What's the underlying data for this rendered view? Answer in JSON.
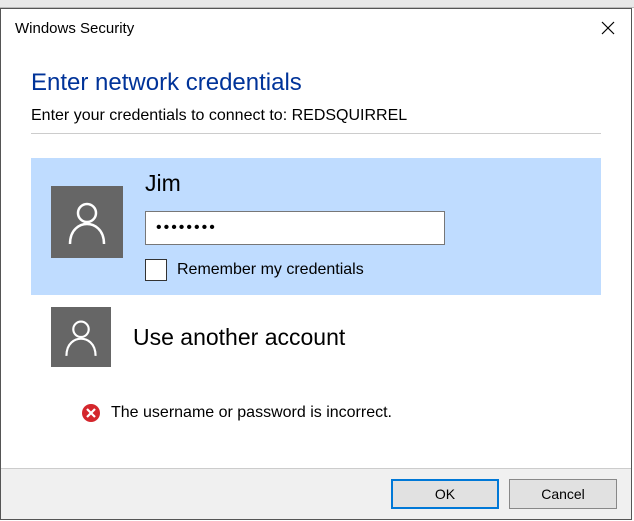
{
  "titlebar": {
    "title": "Windows Security"
  },
  "heading": "Enter network credentials",
  "subheading": "Enter your credentials to connect to: REDSQUIRREL",
  "account": {
    "username": "Jim",
    "password_masked": "••••••••",
    "remember_label": "Remember my credentials"
  },
  "alt_account": {
    "label": "Use another account"
  },
  "error": {
    "message": "The username or password is incorrect."
  },
  "buttons": {
    "ok": "OK",
    "cancel": "Cancel"
  }
}
